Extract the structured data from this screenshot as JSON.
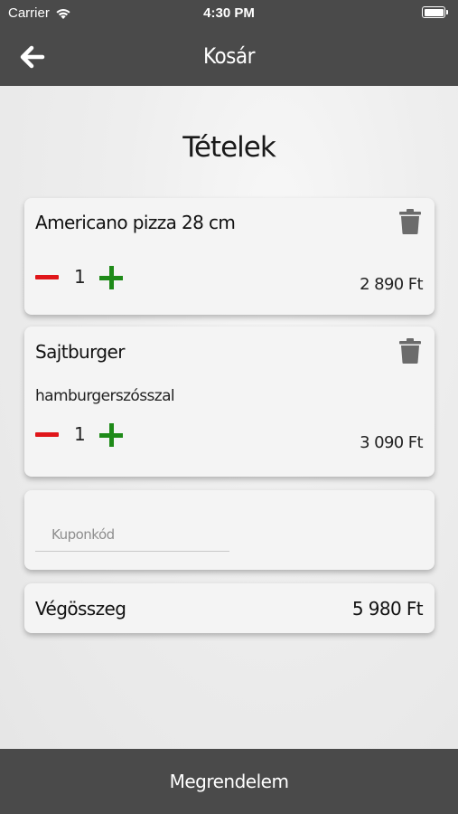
{
  "status_bar": {
    "carrier": "Carrier",
    "time": "4:30 PM",
    "wifi_icon": "wifi-icon",
    "battery_icon": "battery-icon"
  },
  "nav": {
    "title": "Kosár",
    "back_icon": "arrow-left-icon"
  },
  "main": {
    "heading": "Tételek",
    "items": [
      {
        "name": "Americano pizza 28 cm",
        "note": "",
        "quantity": "1",
        "price": "2 890 Ft"
      },
      {
        "name": "Sajtburger",
        "note": "hamburgerszósszal",
        "quantity": "1",
        "price": "3 090 Ft"
      }
    ],
    "coupon": {
      "placeholder": "Kuponkód",
      "value": ""
    },
    "total": {
      "label": "Végösszeg",
      "value": "5 980 Ft"
    }
  },
  "footer": {
    "order_label": "Megrendelem"
  },
  "colors": {
    "bar": "#4a4a4a",
    "minus": "#e0161a",
    "plus": "#1e8a18",
    "trash": "#6b6b6b"
  }
}
